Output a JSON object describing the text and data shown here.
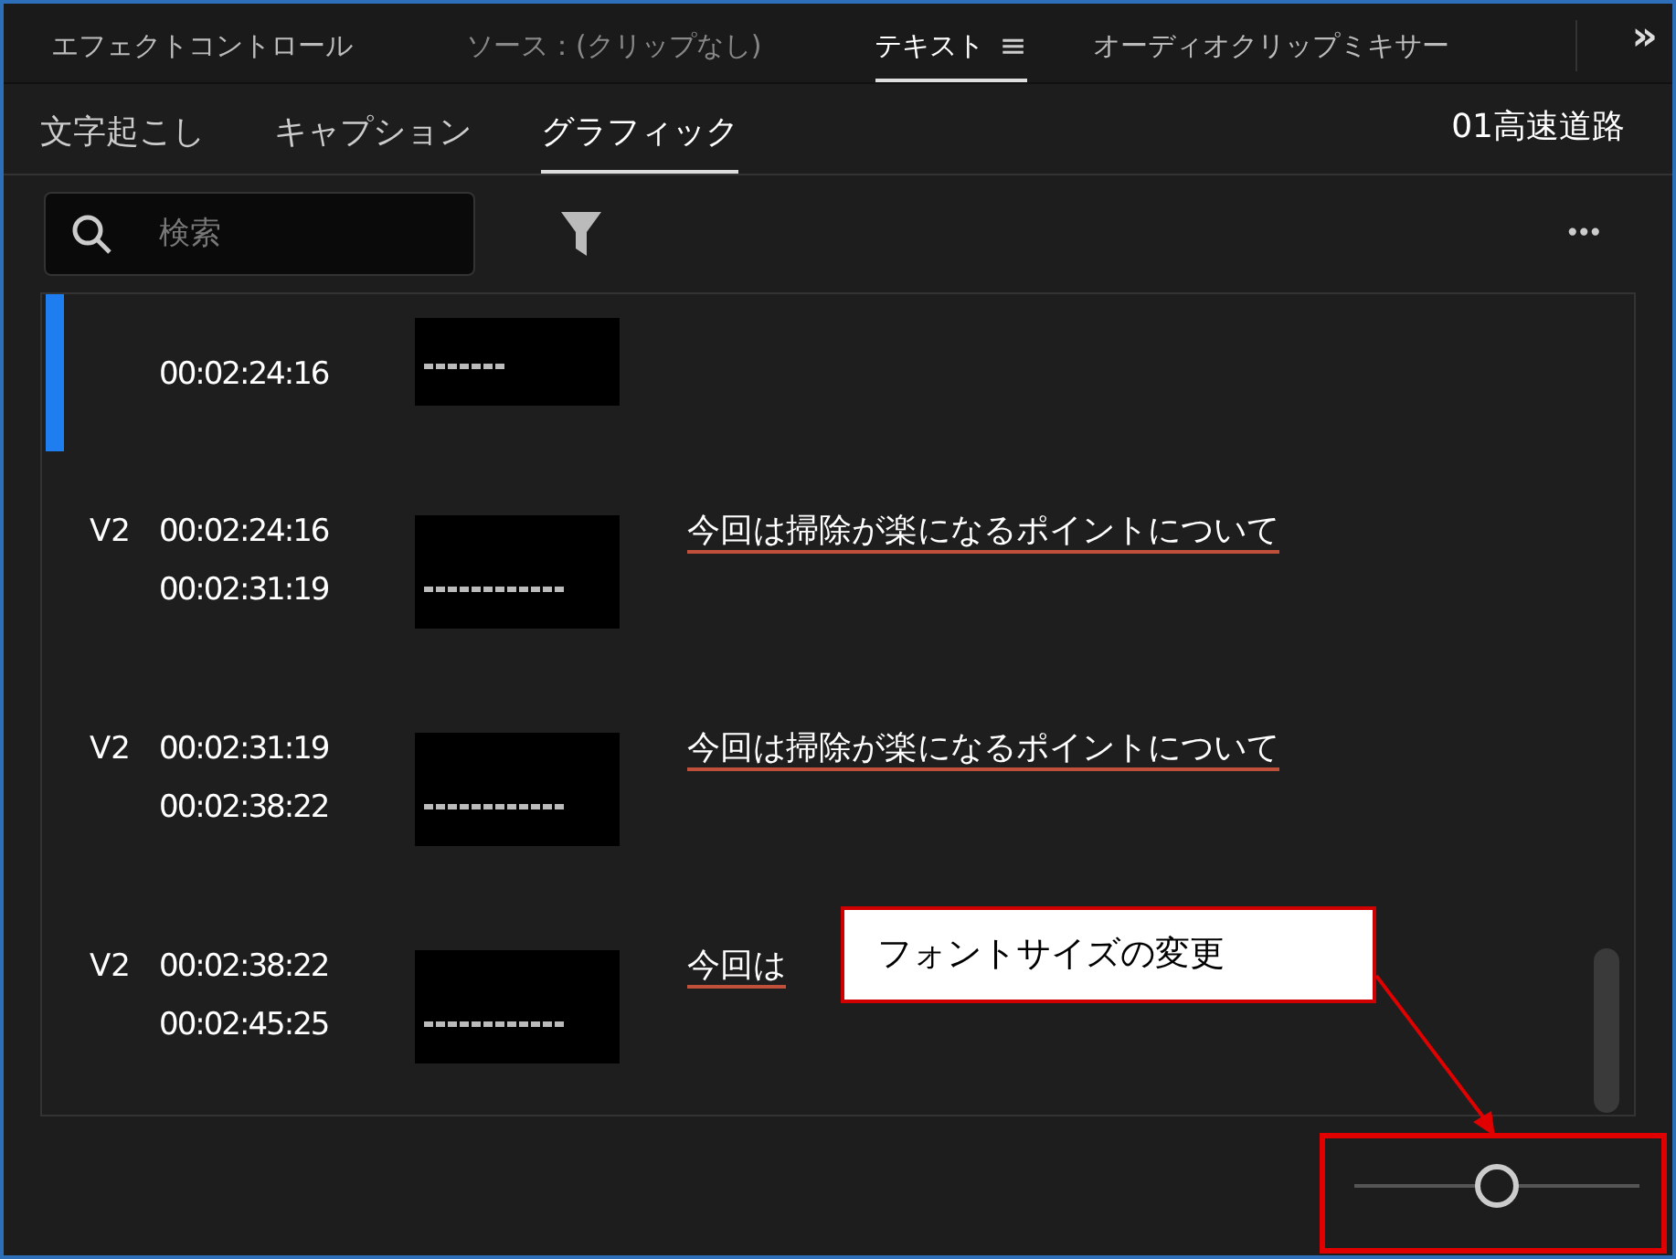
{
  "panel_tabs": [
    {
      "label": "エフェクトコントロール",
      "selected": false,
      "disabled": false
    },
    {
      "label": "ソース：(クリップなし)",
      "selected": false,
      "disabled": true
    },
    {
      "label": "テキスト",
      "selected": true,
      "disabled": false,
      "menu": "≡"
    },
    {
      "label": "オーディオクリップミキサー",
      "selected": false,
      "disabled": false
    }
  ],
  "overflow_button": "»",
  "sub_tabs": [
    {
      "label": "文字起こし",
      "selected": false
    },
    {
      "label": "キャプション",
      "selected": false
    },
    {
      "label": "グラフィック",
      "selected": true
    }
  ],
  "sequence_name": "01高速道路",
  "search": {
    "placeholder": "検索"
  },
  "more_button": "•••",
  "rows": [
    {
      "selected": true,
      "end": "00:02:24:16"
    },
    {
      "selected": false,
      "track": "V2",
      "start": "00:02:24:16",
      "end": "00:02:31:19",
      "caption": "今回は掃除が楽になるポイントについて"
    },
    {
      "selected": false,
      "track": "V2",
      "start": "00:02:31:19",
      "end": "00:02:38:22",
      "caption": "今回は掃除が楽になるポイントについて"
    },
    {
      "selected": false,
      "track": "V2",
      "start": "00:02:38:22",
      "end": "00:02:45:25",
      "caption": "今回は"
    }
  ],
  "font_size_slider": {
    "level": 0.5
  },
  "annotation": {
    "text": "フォントサイズの変更"
  }
}
